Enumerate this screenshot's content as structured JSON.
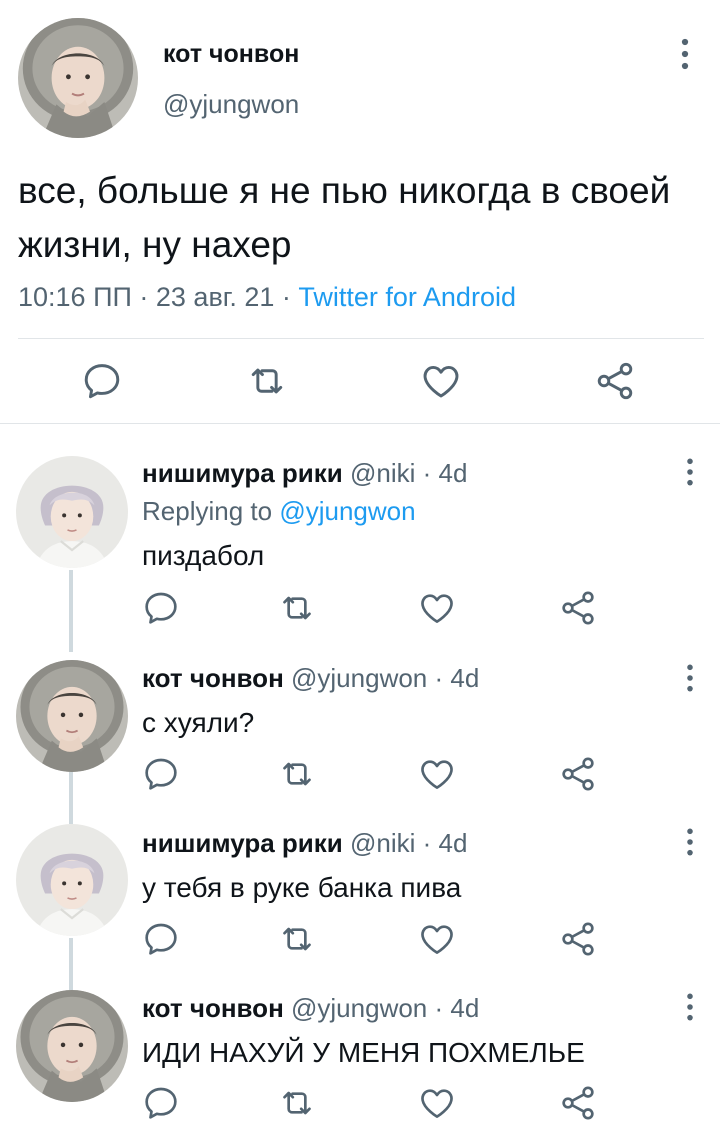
{
  "main_tweet": {
    "author_name": "кот чонвон",
    "author_handle": "@yjungwon",
    "text": "все, больше я не пью никогда в своей жизни, ну нахер",
    "time": "10:16 ПП",
    "dot1": " · ",
    "date": "23 авг. 21",
    "dot2": " · ",
    "source": "Twitter for Android",
    "avatar_icon": "avatar-hooded-person",
    "actions": [
      "reply-icon",
      "retweet-icon",
      "like-icon",
      "share-icon"
    ]
  },
  "replies": [
    {
      "author_name": "нишимура рики",
      "author_handle": "@niki",
      "separator": " · ",
      "time": "4d",
      "replying_prefix": "Replying to ",
      "replying_mention": "@yjungwon",
      "text": "пиздабол",
      "avatar_icon": "avatar-silver-hair-person"
    },
    {
      "author_name": "кот чонвон",
      "author_handle": "@yjungwon",
      "separator": " · ",
      "time": "4d",
      "text": "с хуяли?",
      "avatar_icon": "avatar-hooded-person"
    },
    {
      "author_name": "нишимура рики",
      "author_handle": "@niki",
      "separator": " · ",
      "time": "4d",
      "text": "у тебя в руке банка пива",
      "avatar_icon": "avatar-silver-hair-person"
    },
    {
      "author_name": "кот чонвон",
      "author_handle": "@yjungwon",
      "separator": " · ",
      "time": "4d",
      "text": "ИДИ НАХУЙ У МЕНЯ ПОХМЕЛЬЕ",
      "avatar_icon": "avatar-hooded-person"
    }
  ],
  "colors": {
    "text_primary": "#0f1419",
    "text_secondary": "#536471",
    "link": "#1d9bf0",
    "divider": "#e1e5e8",
    "thread_line": "#cfd9de"
  }
}
